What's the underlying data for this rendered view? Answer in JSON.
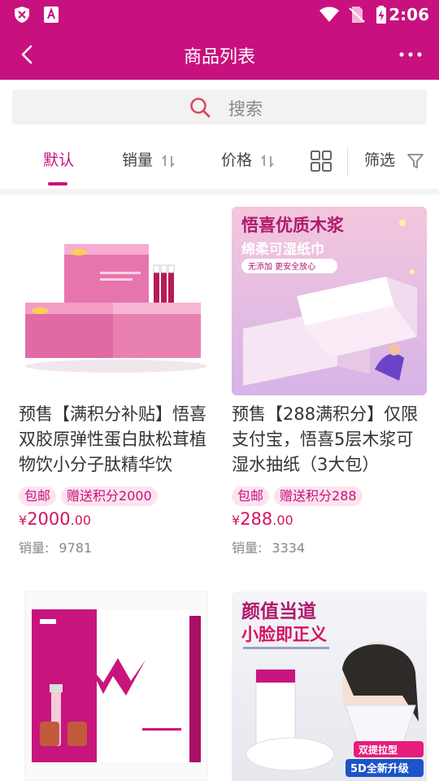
{
  "status_bar": {
    "time": "2:06"
  },
  "header": {
    "title": "商品列表"
  },
  "search": {
    "placeholder": "搜索"
  },
  "sort_tabs": [
    {
      "label": "默认",
      "active": true
    },
    {
      "label": "销量"
    },
    {
      "label": "价格"
    }
  ],
  "filter_label": "筛选",
  "products": [
    {
      "name": "预售【满积分补贴】悟喜双胶原弹性蛋白肽松茸植物饮小分子肽精华饮",
      "tags": [
        "包邮",
        "赠送积分2000"
      ],
      "price_symbol": "¥",
      "price_int": "2000",
      "price_dec": ".00",
      "sales_label": "销量:",
      "sales_value": "9781"
    },
    {
      "name": "预售【288满积分】仅限支付宝，悟喜5层木浆可湿水抽纸（3大包）",
      "tags": [
        "包邮",
        "赠送积分288"
      ],
      "price_symbol": "¥",
      "price_int": "288",
      "price_dec": ".00",
      "sales_label": "销量:",
      "sales_value": "3334",
      "image_text": {
        "line1": "悟喜优质木浆",
        "line2": "绵柔可湿纸巾",
        "line3": "无添加 更安全放心"
      }
    },
    {
      "image_text": {}
    },
    {
      "image_text": {
        "line1": "颜值当道",
        "line2": "小脸即正义",
        "badge1": "双提拉型",
        "badge2": "5D全新升级"
      }
    }
  ],
  "colors": {
    "brand": "#c8117e",
    "price": "#d41461",
    "tag_bg": "#fce4ee"
  }
}
